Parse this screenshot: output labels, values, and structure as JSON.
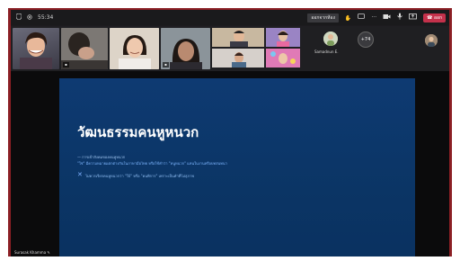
{
  "topbar": {
    "timer": "55:34",
    "record_label": "ออกจากห้อง",
    "leave_label": "ออก",
    "more_label": "···"
  },
  "participants": {
    "others_count": "+74",
    "others_name": "Samadnun E."
  },
  "slide": {
    "title": "วัฒนธรรมคนหูหนวก",
    "subtitle": "— การเข้าสังคมของคนหูหนวก",
    "line1": "\"ใช่\" มีความหมายแตกต่างกันในภาษามือไทย หรือใช้คำว่า \"หนูหนวก\" แทนในงานหรือบทสนทนา",
    "line2": "ไม่ควรเรียกคนหูหนวกว่า \"ใบ้\" หรือ \"คนพิการ\" เพราะเป็นคำที่ไม่สุภาพ"
  },
  "presenter": {
    "name": "Surasak Khamma ✎"
  },
  "colors": {
    "accent_red": "#c4314b",
    "frame_red": "#8b1f24",
    "slide_blue": "#0c376a"
  }
}
